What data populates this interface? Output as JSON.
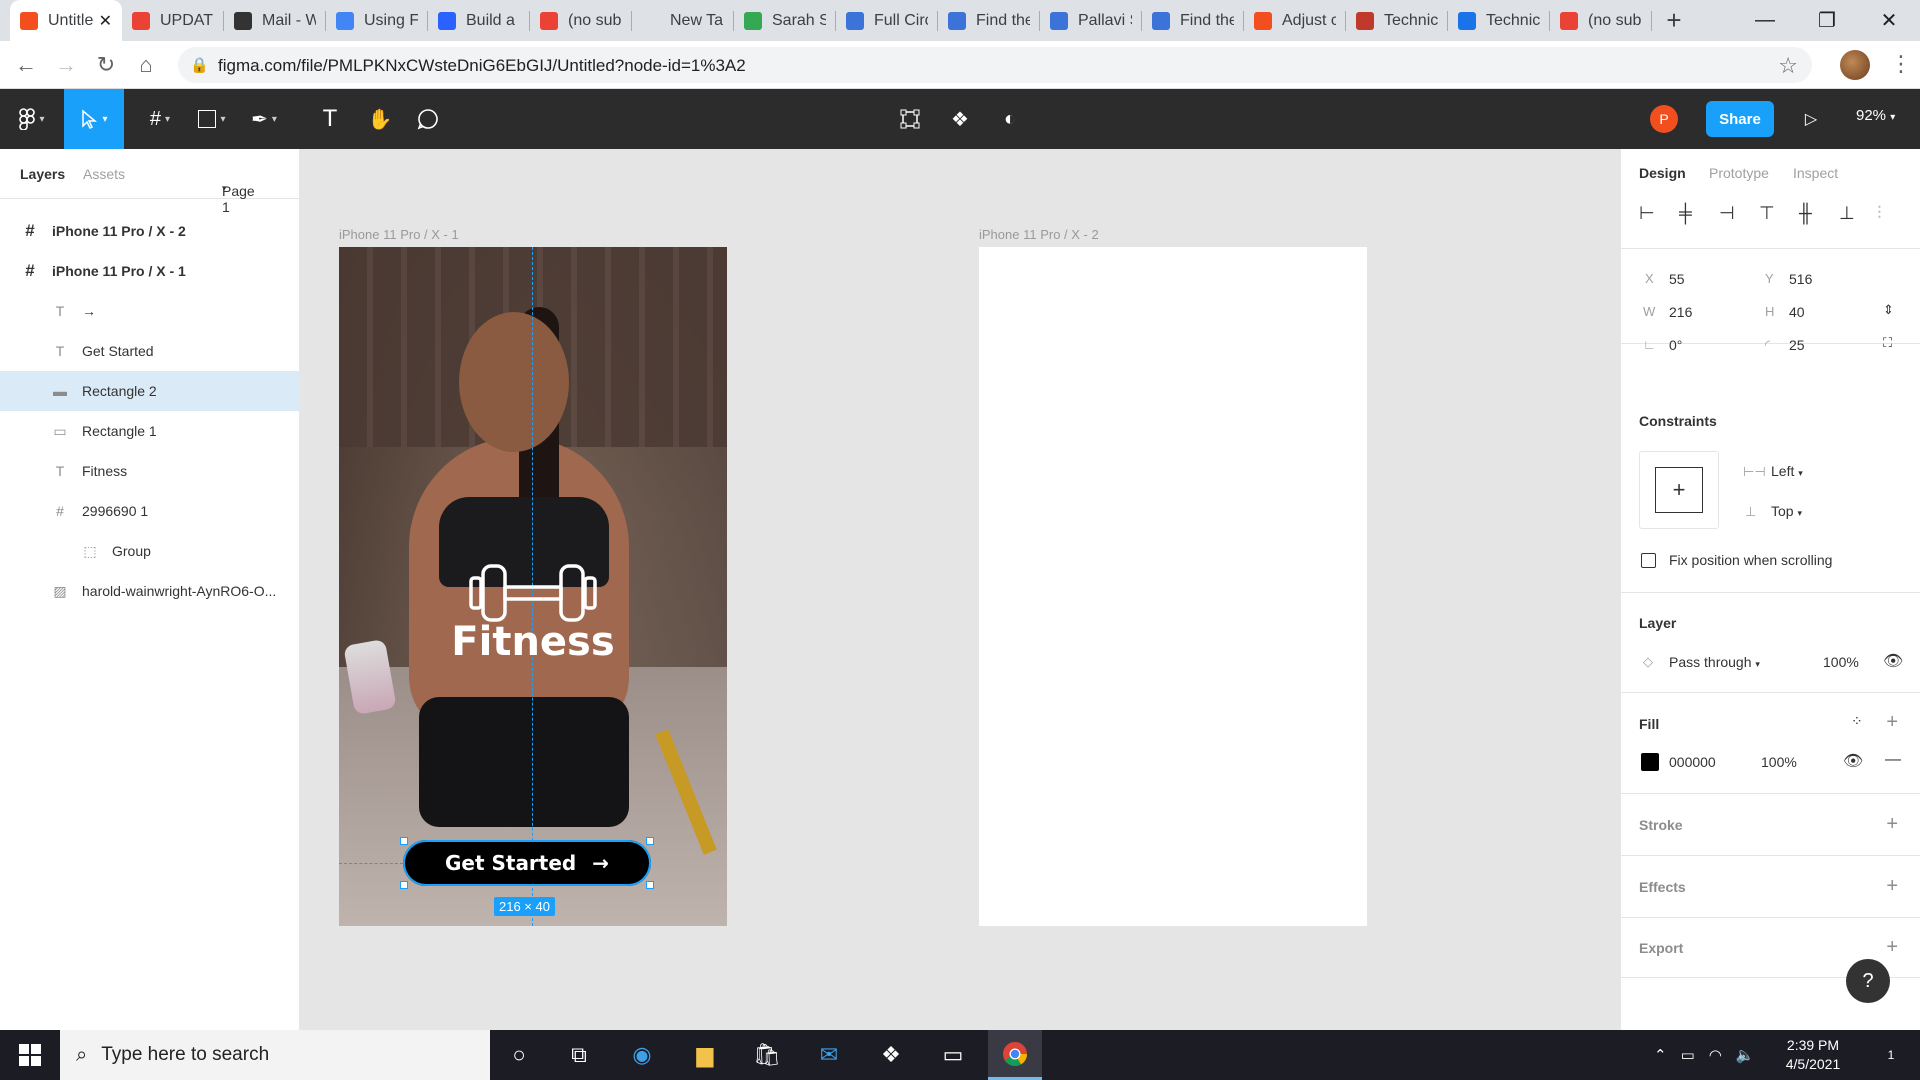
{
  "browser": {
    "tabs": [
      {
        "title": "Untitled",
        "icon": "figma-icon",
        "color": "#f24e1e",
        "active": true
      },
      {
        "title": "UPDATE",
        "icon": "gmail-icon",
        "color": "#ea4335"
      },
      {
        "title": "Mail - W",
        "icon": "mail-wave-icon",
        "color": "#333333"
      },
      {
        "title": "Using Fi",
        "icon": "docs-icon",
        "color": "#4285f4"
      },
      {
        "title": "Build a",
        "icon": "pluralsight-icon",
        "color": "#2962ff"
      },
      {
        "title": "(no sub",
        "icon": "gmail-icon",
        "color": "#ea4335"
      },
      {
        "title": "New Tab",
        "icon": "none",
        "color": "#dee1e6"
      },
      {
        "title": "Sarah S",
        "icon": "leaf-icon",
        "color": "#34a853"
      },
      {
        "title": "Full Circ",
        "icon": "pt-icon",
        "color": "#3b73d9"
      },
      {
        "title": "Find the",
        "icon": "pt-icon",
        "color": "#3b73d9"
      },
      {
        "title": "Pallavi S",
        "icon": "pt-icon",
        "color": "#3b73d9"
      },
      {
        "title": "Find the",
        "icon": "pt-icon",
        "color": "#3b73d9"
      },
      {
        "title": "Adjust c",
        "icon": "figma-icon",
        "color": "#f24e1e"
      },
      {
        "title": "Technic",
        "icon": "technic-icon",
        "color": "#c0392b"
      },
      {
        "title": "Technic",
        "icon": "circle-arrow-icon",
        "color": "#1a73e8"
      },
      {
        "title": "(no sub",
        "icon": "gmail-icon",
        "color": "#ea4335"
      }
    ],
    "url": "figma.com/file/PMLPKNxCWsteDniG6EbGIJ/Untitled?node-id=1%3A2"
  },
  "toolbar": {
    "share_label": "Share",
    "avatar_initial": "P",
    "zoom": "92%"
  },
  "left_panel": {
    "tab_layers": "Layers",
    "tab_assets": "Assets",
    "page": "Page 1",
    "layers": [
      {
        "name": "iPhone 11 Pro / X - 2",
        "type": "frame",
        "indent": 0
      },
      {
        "name": "iPhone 11 Pro / X - 1",
        "type": "frame",
        "indent": 0
      },
      {
        "name": "→",
        "type": "text",
        "indent": 1
      },
      {
        "name": "Get Started",
        "type": "text",
        "indent": 1
      },
      {
        "name": "Rectangle 2",
        "type": "rect-fill",
        "indent": 1,
        "selected": true
      },
      {
        "name": "Rectangle 1",
        "type": "rect",
        "indent": 1
      },
      {
        "name": "Fitness",
        "type": "text",
        "indent": 1
      },
      {
        "name": "2996690 1",
        "type": "frame",
        "indent": 1
      },
      {
        "name": "Group",
        "type": "group",
        "indent": 2
      },
      {
        "name": "harold-wainwright-AynRO6-O...",
        "type": "image",
        "indent": 1
      }
    ]
  },
  "canvas": {
    "frame1_label": "iPhone 11 Pro / X - 1",
    "frame2_label": "iPhone 11 Pro / X - 2",
    "fitness_title": "Fitness",
    "button_label": "Get Started",
    "button_arrow": "→",
    "size_badge": "216 × 40"
  },
  "right_panel": {
    "tabs": [
      "Design",
      "Prototype",
      "Inspect"
    ],
    "x": "55",
    "y": "516",
    "w": "216",
    "h": "40",
    "rotation": "0°",
    "radius": "25",
    "constraints_title": "Constraints",
    "constraint_h": "Left",
    "constraint_v": "Top",
    "fix_position": "Fix position when scrolling",
    "layer_title": "Layer",
    "blend_mode": "Pass through",
    "layer_opacity": "100%",
    "fill_title": "Fill",
    "fill_hex": "000000",
    "fill_opacity": "100%",
    "stroke_title": "Stroke",
    "effects_title": "Effects",
    "export_title": "Export",
    "help": "?"
  },
  "taskbar": {
    "search_placeholder": "Type here to search",
    "time": "2:39 PM",
    "date": "4/5/2021",
    "notifications": "1"
  }
}
